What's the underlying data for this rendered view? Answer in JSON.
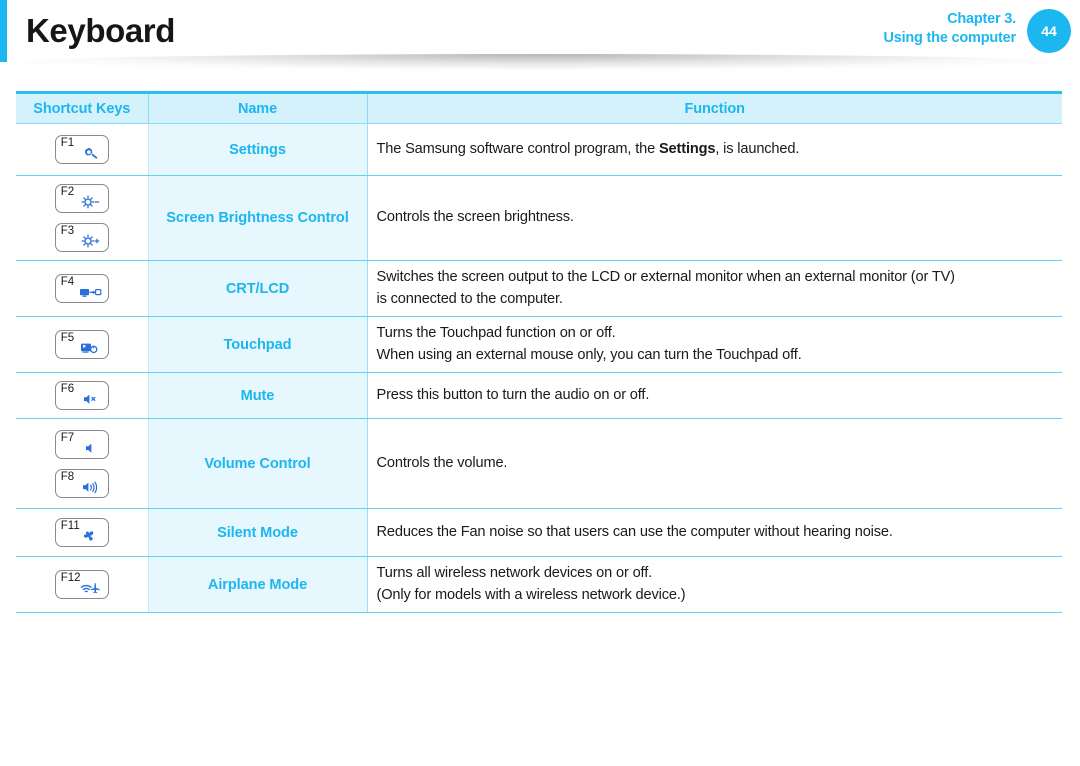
{
  "header": {
    "title": "Keyboard",
    "chapter_line1": "Chapter 3.",
    "chapter_line2": "Using the computer",
    "page_number": "44",
    "accent_color": "#1cb7ef",
    "title_color": "#161616"
  },
  "table": {
    "columns": {
      "keys": "Shortcut Keys",
      "name": "Name",
      "function": "Function"
    },
    "header_bg": "#d5f2fc",
    "header_text_color": "#1cb7ef",
    "name_cell_bg": "#e6f7fd",
    "name_text_color": "#1cb7ef",
    "border_color": "#5fd2f5",
    "rows": [
      {
        "keys": [
          {
            "label": "F1",
            "icon": "settings-gear-icon"
          }
        ],
        "name": "Settings",
        "function_lines": [
          "The Samsung software control program, the Settings, is launched."
        ],
        "bold_terms": [
          "Settings"
        ]
      },
      {
        "keys": [
          {
            "label": "F2",
            "icon": "brightness-down-icon"
          },
          {
            "label": "F3",
            "icon": "brightness-up-icon"
          }
        ],
        "name": "Screen Brightness Control",
        "function_lines": [
          "Controls the screen brightness."
        ],
        "bold_terms": []
      },
      {
        "keys": [
          {
            "label": "F4",
            "icon": "external-monitor-icon"
          }
        ],
        "name": "CRT/LCD",
        "function_lines": [
          "Switches the screen output to the LCD or external monitor when an external monitor (or TV)",
          "is connected to the computer."
        ],
        "bold_terms": []
      },
      {
        "keys": [
          {
            "label": "F5",
            "icon": "touchpad-icon"
          }
        ],
        "name": "Touchpad",
        "function_lines": [
          "Turns the Touchpad function on or off.",
          "When using an external mouse only, you can turn the Touchpad off."
        ],
        "bold_terms": []
      },
      {
        "keys": [
          {
            "label": "F6",
            "icon": "mute-speaker-icon"
          }
        ],
        "name": "Mute",
        "function_lines": [
          "Press this button to turn the audio on or off."
        ],
        "bold_terms": []
      },
      {
        "keys": [
          {
            "label": "F7",
            "icon": "volume-down-icon"
          },
          {
            "label": "F8",
            "icon": "volume-up-icon"
          }
        ],
        "name": "Volume Control",
        "function_lines": [
          "Controls the volume."
        ],
        "bold_terms": []
      },
      {
        "keys": [
          {
            "label": "F11",
            "icon": "fan-icon"
          }
        ],
        "name": "Silent Mode",
        "function_lines": [
          "Reduces the Fan noise so that users can use the computer without hearing noise."
        ],
        "bold_terms": []
      },
      {
        "keys": [
          {
            "label": "F12",
            "icon": "wireless-airplane-icon"
          }
        ],
        "name": "Airplane Mode",
        "function_lines": [
          "Turns all wireless network devices on or off.",
          "(Only for models with a wireless network device.)"
        ],
        "bold_terms": []
      }
    ]
  }
}
